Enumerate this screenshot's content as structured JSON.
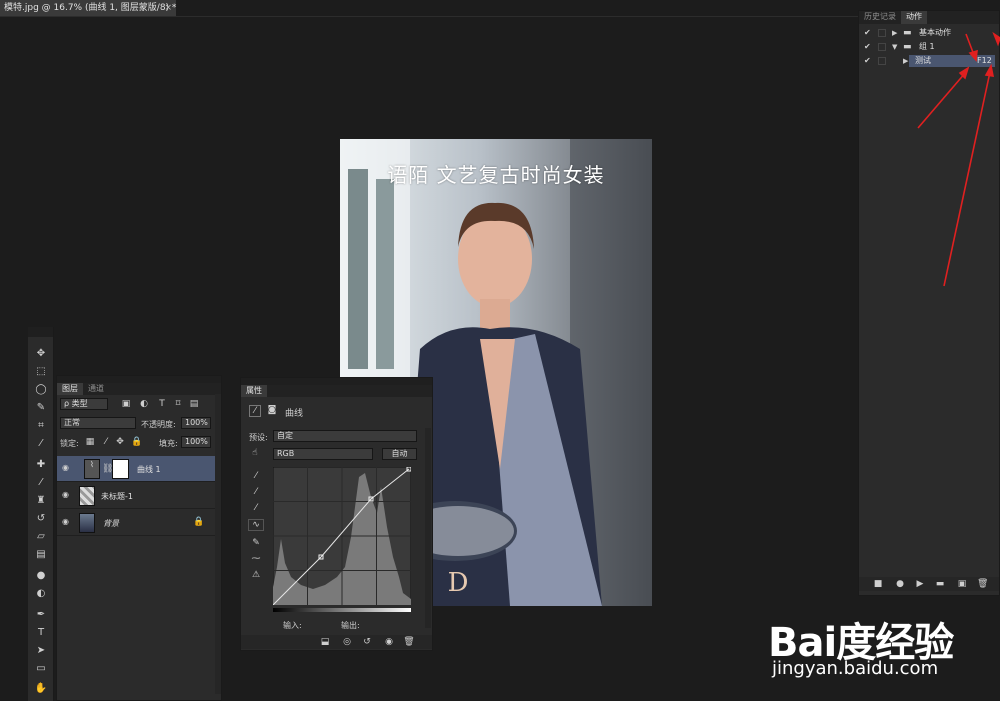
{
  "document": {
    "tab_title": "模特.jpg @ 16.7% (曲线 1, 图层蒙版/8) *",
    "close": "×",
    "canvas_caption": "语陌  文艺复古时尚女装"
  },
  "toolbar": {
    "tools": [
      "move-tool-icon",
      "marquee-tool-icon",
      "lasso-tool-icon",
      "quick-select-tool-icon",
      "crop-tool-icon",
      "eyedropper-tool-icon",
      "healing-brush-tool-icon",
      "brush-tool-icon",
      "clone-stamp-tool-icon",
      "history-brush-tool-icon",
      "eraser-tool-icon",
      "gradient-tool-icon",
      "blur-tool-icon",
      "dodge-tool-icon",
      "pen-tool-icon",
      "type-tool-icon",
      "path-select-tool-icon",
      "rectangle-tool-icon",
      "hand-tool-icon"
    ]
  },
  "layers_panel": {
    "tabs": [
      "图层",
      "通道"
    ],
    "filter_kind": "ρ 类型",
    "blend_mode": "正常",
    "opacity_label": "不透明度:",
    "opacity_value": "100%",
    "lock_label": "锁定:",
    "fill_label": "填充:",
    "fill_value": "100%",
    "layers": [
      {
        "name": "曲线 1",
        "selected": true
      },
      {
        "name": "未标题-1",
        "selected": false
      },
      {
        "name": "背景",
        "selected": false
      }
    ]
  },
  "properties_panel": {
    "title": "属性",
    "adjustment_name": "曲线",
    "preset_label": "预设:",
    "preset_value": "自定",
    "channel_value": "RGB",
    "auto_button": "自动",
    "input_label": "输入:",
    "output_label": "输出:"
  },
  "actions_panel": {
    "tabs": [
      "历史记录",
      "动作"
    ],
    "rows": [
      {
        "label": "基本动作",
        "type": "set",
        "expanded": false
      },
      {
        "label": "组 1",
        "type": "set",
        "expanded": true
      },
      {
        "label": "测试",
        "type": "action",
        "shortcut": "F12",
        "selected": true
      }
    ]
  },
  "watermark": {
    "logo": "Bai度经验",
    "url": "jingyan.baidu.com"
  },
  "colors": {
    "panel_bg": "#2b2b2b",
    "selection": "#4a5670",
    "annotation_arrow": "#e02020"
  }
}
